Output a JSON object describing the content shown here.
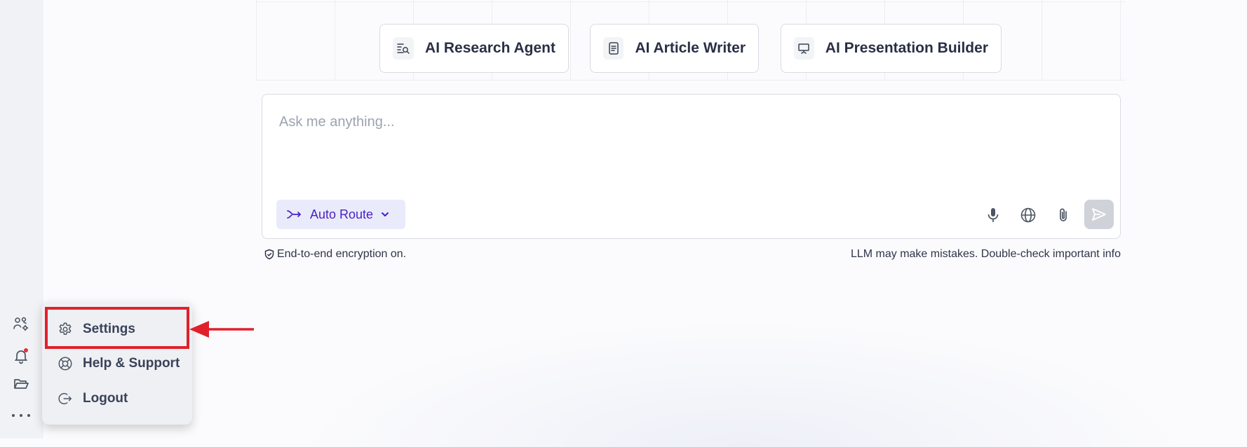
{
  "quick_actions": [
    {
      "label": "AI Research Agent",
      "icon": "search-list-icon"
    },
    {
      "label": "AI Article Writer",
      "icon": "document-icon"
    },
    {
      "label": "AI Presentation Builder",
      "icon": "presentation-icon"
    }
  ],
  "composer": {
    "placeholder": "Ask me anything...",
    "route_label": "Auto Route",
    "route_color": "#4a1fc4"
  },
  "footer": {
    "encryption": "End-to-end encryption on.",
    "disclaimer": "LLM may make mistakes. Double-check important info"
  },
  "sidebar": {
    "icons": [
      "users-settings-icon",
      "bell-icon",
      "folder-icon",
      "more-icon"
    ]
  },
  "menu": {
    "items": [
      {
        "label": "Settings",
        "icon": "gear-icon"
      },
      {
        "label": "Help & Support",
        "icon": "lifebuoy-icon"
      },
      {
        "label": "Logout",
        "icon": "logout-icon"
      }
    ]
  },
  "annotation": {
    "highlight_color": "#e0212b"
  }
}
